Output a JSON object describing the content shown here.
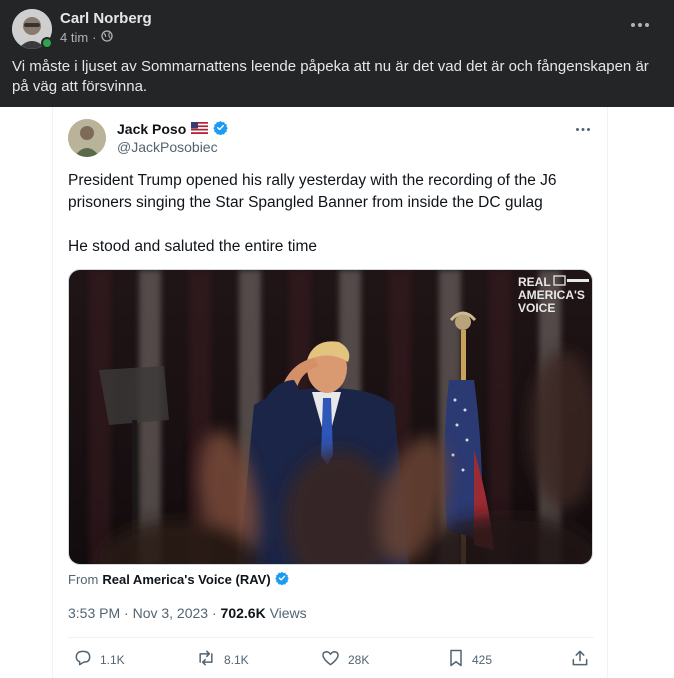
{
  "post": {
    "author": "Carl Norberg",
    "time": "4 tim",
    "separator": "·",
    "text": "Vi måste i ljuset av Sommarnattens leende påpeka att nu är det vad det är och fångenskapen är på väg att försvinna.",
    "colors": {
      "background": "#242526",
      "text": "#e4e6eb",
      "online": "#31a24c"
    }
  },
  "tweet": {
    "name": "Jack Poso",
    "handle": "@JackPosobiec",
    "body": [
      "President Trump opened his rally yesterday with the recording of the J6 prisoners singing the Star Spangled Banner from inside the DC gulag",
      "He stood and saluted the entire time"
    ],
    "media": {
      "watermark_lines": [
        "REAL",
        "AMERICA'S",
        "VOICE"
      ]
    },
    "from_label": "From",
    "from_source": "Real America's Voice (RAV)",
    "time": "3:53 PM · Nov 3, 2023",
    "time_separator": "·",
    "views_count": "702.6K",
    "views_label": "Views",
    "actions": {
      "replies": "1.1K",
      "retweets": "8.1K",
      "likes": "28K",
      "bookmarks": "425"
    },
    "colors": {
      "verified": "#1d9bf0",
      "text": "#0f1419",
      "muted": "#536471"
    }
  }
}
